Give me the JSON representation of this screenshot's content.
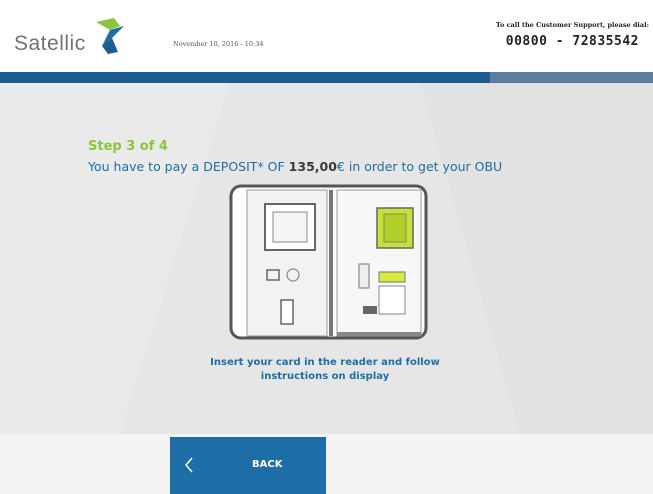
{
  "header": {
    "logo_text": "Satellic",
    "datetime": "November 10, 2016 - 10:34",
    "support_label": "To call the Customer Support, please dial:",
    "support_phone": "00800 - 72835542"
  },
  "progress": {
    "current_step": 3,
    "total_steps": 4,
    "fraction": 0.75
  },
  "main": {
    "step_label": "Step 3 of 4",
    "instruction_prefix": "You have to pay a DEPOSIT* OF ",
    "deposit_amount": "135,00",
    "currency": "€",
    "instruction_suffix": " in order to get your OBU",
    "caption_line1": "Insert your card in the reader and follow",
    "caption_line2": "instructions on display"
  },
  "footer": {
    "back_label": "BACK"
  },
  "colors": {
    "brand_blue": "#1d6ea6",
    "brand_green": "#8cc43c",
    "bar_dark": "#1d5d93",
    "bar_light": "#5a7ea0",
    "panel_gray": "#e6e6e6"
  },
  "icons": {
    "logo": "satellic-arrow-logo",
    "back": "chevron-left-icon",
    "illustration": "payment-terminal-illustration"
  }
}
